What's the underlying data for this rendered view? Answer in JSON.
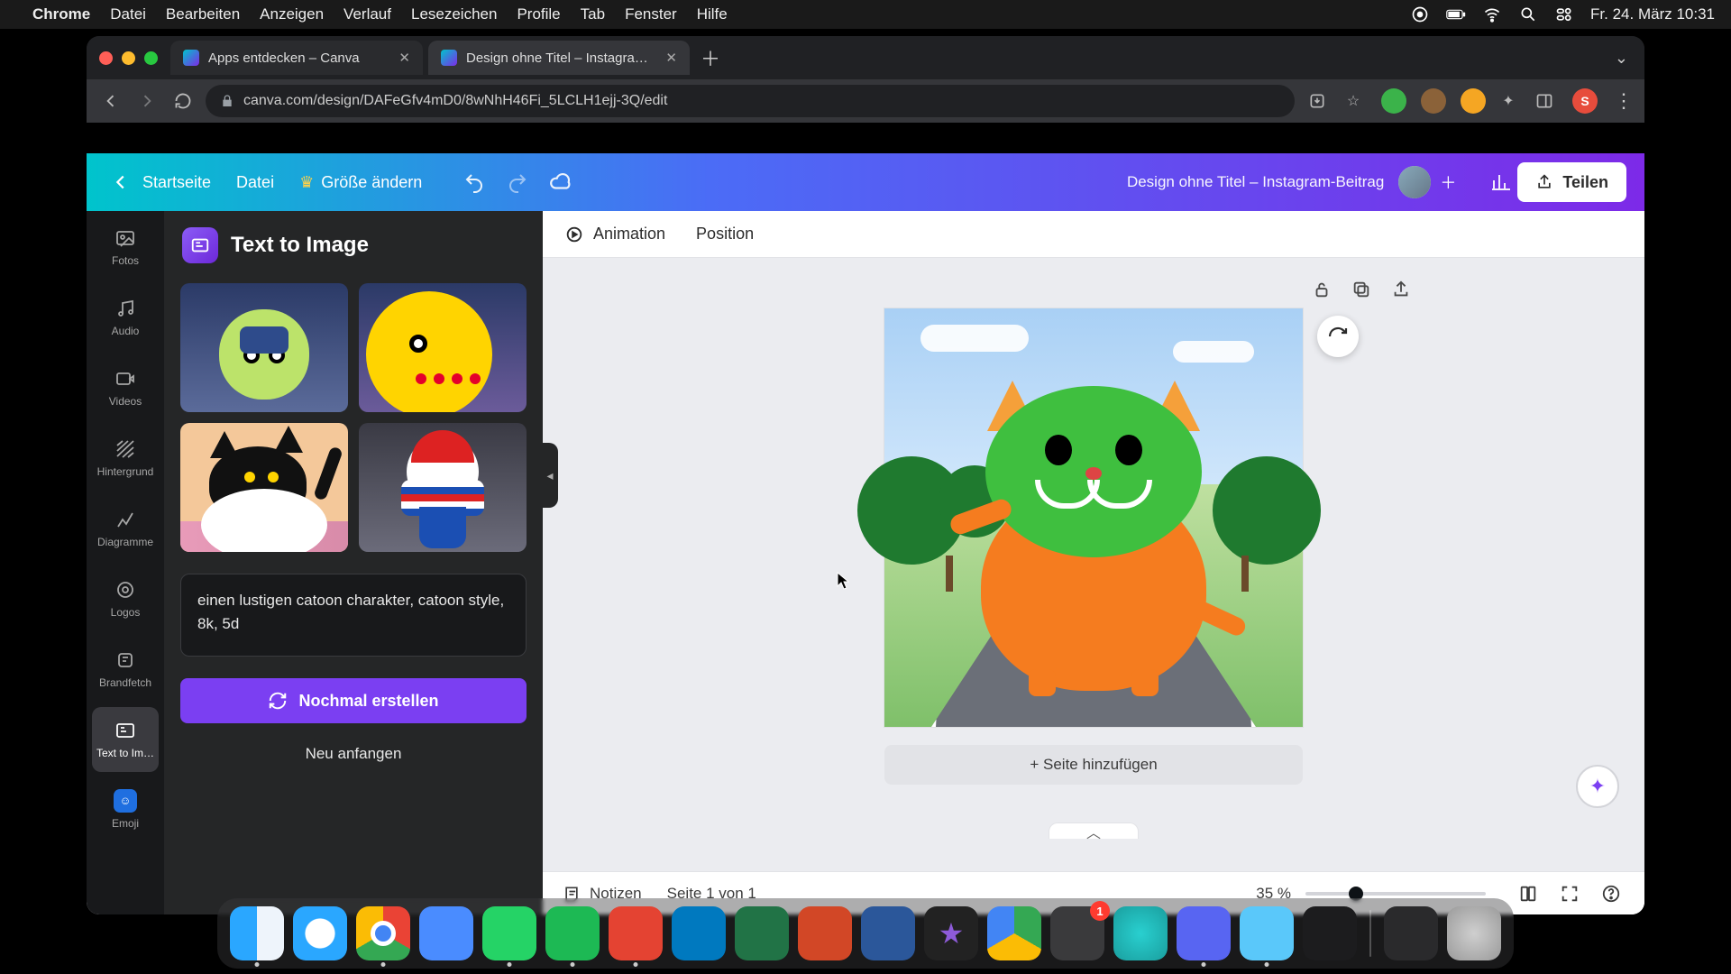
{
  "mac_menu": {
    "app": "Chrome",
    "items": [
      "Datei",
      "Bearbeiten",
      "Anzeigen",
      "Verlauf",
      "Lesezeichen",
      "Profile",
      "Tab",
      "Fenster",
      "Hilfe"
    ],
    "clock": "Fr. 24. März  10:31"
  },
  "browser": {
    "tabs": [
      {
        "title": "Apps entdecken – Canva"
      },
      {
        "title": "Design ohne Titel – Instagram-…"
      }
    ],
    "url": "canva.com/design/DAFeGfv4mD0/8wNhH46Fi_5LCLH1ejj-3Q/edit",
    "profile_initial": "S"
  },
  "canva_header": {
    "home": "Startseite",
    "file": "Datei",
    "resize": "Größe ändern",
    "title": "Design ohne Titel – Instagram-Beitrag",
    "share": "Teilen"
  },
  "tool_rail": [
    {
      "key": "fotos",
      "label": "Fotos"
    },
    {
      "key": "audio",
      "label": "Audio"
    },
    {
      "key": "videos",
      "label": "Videos"
    },
    {
      "key": "hintergrund",
      "label": "Hintergrund"
    },
    {
      "key": "diagramme",
      "label": "Diagramme"
    },
    {
      "key": "logos",
      "label": "Logos"
    },
    {
      "key": "brandfetch",
      "label": "Brandfetch"
    },
    {
      "key": "text_to_image",
      "label": "Text to Im…"
    },
    {
      "key": "emoji",
      "label": "Emoji"
    }
  ],
  "panel": {
    "title": "Text to Image",
    "prompt": "einen lustigen catoon charakter, catoon style, 8k, 5d",
    "regen": "Nochmal erstellen",
    "reset": "Neu anfangen"
  },
  "context_bar": {
    "animation": "Animation",
    "position": "Position"
  },
  "canvas": {
    "add_page": "+ Seite hinzufügen"
  },
  "footer": {
    "notes": "Notizen",
    "page_indicator": "Seite 1 von 1",
    "zoom": "35 %"
  },
  "dock": {
    "settings_badge": "1"
  },
  "colors": {
    "accent_purple": "#7b3ff2"
  }
}
